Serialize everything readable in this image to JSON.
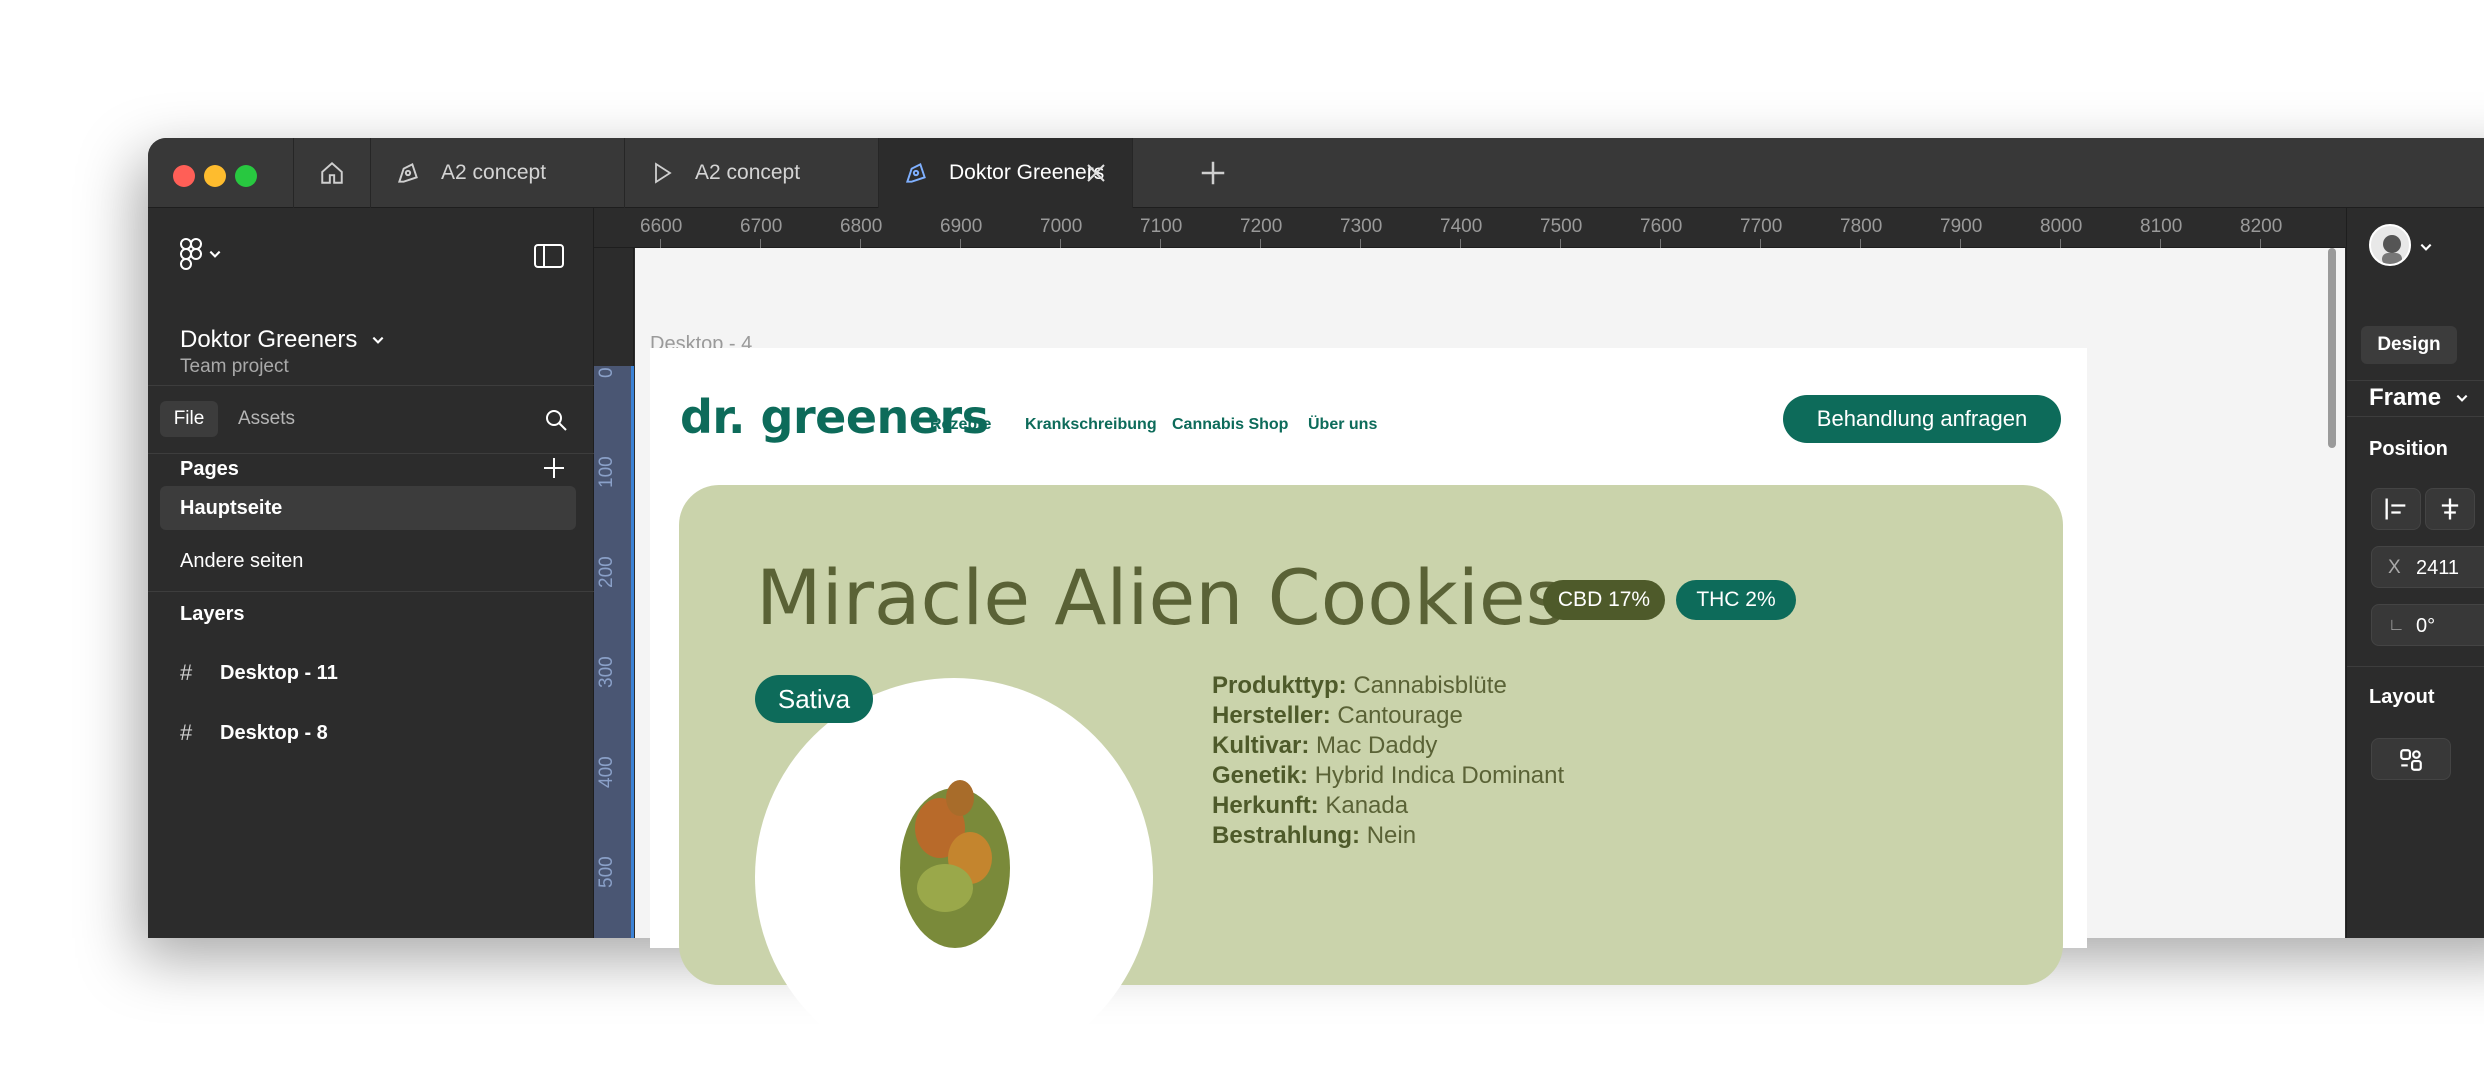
{
  "tabs": [
    {
      "label": "A2 concept",
      "icon": "pen-tool-icon"
    },
    {
      "label": "A2 concept",
      "icon": "play-icon"
    },
    {
      "label": "Doktor Greeners",
      "icon": "pen-tool-icon",
      "active": true
    }
  ],
  "left_panel": {
    "project_name": "Doktor Greeners",
    "project_sub": "Team project",
    "file_tab": "File",
    "assets_tab": "Assets",
    "pages_title": "Pages",
    "pages": [
      "Hauptseite",
      "Andere seiten"
    ],
    "layers_title": "Layers",
    "layers": [
      "Desktop - 11",
      "Desktop - 8"
    ]
  },
  "ruler": {
    "top": [
      "6600",
      "6700",
      "6800",
      "6900",
      "7000",
      "7100",
      "7200",
      "7300",
      "7400",
      "7500",
      "7600",
      "7700",
      "7800",
      "7900",
      "8000",
      "8100",
      "8200"
    ],
    "left": [
      "0",
      "100",
      "200",
      "300",
      "400",
      "500"
    ]
  },
  "canvas": {
    "frame_label": "Desktop - 4",
    "site": {
      "logo": "dr. greeners",
      "nav": [
        "Rezepte",
        "Krankschreibung",
        "Cannabis Shop",
        "Über uns"
      ],
      "cta": "Behandlung anfragen",
      "hero": {
        "title": "Miracle Alien Cookies",
        "cbd": "CBD 17%",
        "thc": "THC 2%",
        "strain": "Sativa",
        "specs": [
          {
            "k": "Produkttyp:",
            "v": "Cannabisblüte"
          },
          {
            "k": "Hersteller:",
            "v": "Cantourage"
          },
          {
            "k": "Kultivar:",
            "v": "Mac Daddy"
          },
          {
            "k": "Genetik:",
            "v": "Hybrid Indica Dominant"
          },
          {
            "k": "Herkunft:",
            "v": "Kanada"
          },
          {
            "k": "Bestrahlung:",
            "v": "Nein"
          }
        ]
      }
    }
  },
  "right_panel": {
    "design_tab": "Design",
    "frame_label": "Frame",
    "position_title": "Position",
    "x_label": "X",
    "x_value": "2411",
    "rotation_value": "0°",
    "layout_title": "Layout"
  },
  "colors": {
    "brand": "#0d6b5a",
    "hero_bg": "#cad3ab",
    "olive": "#4e5a2a"
  }
}
